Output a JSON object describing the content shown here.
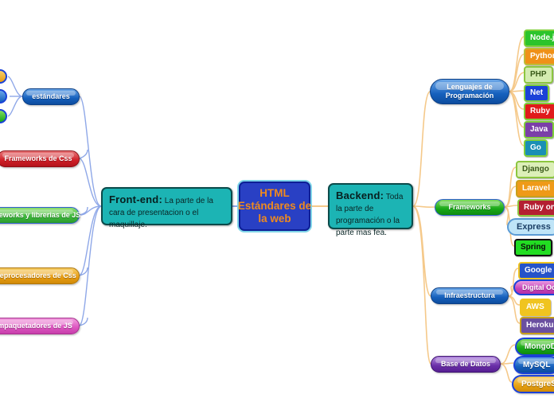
{
  "diagram": {
    "title": "HTML Estándares de la web",
    "background_color": "#ffffff",
    "link_color_left": "#8fa8e8",
    "link_color_right": "#f5c98a"
  },
  "central": {
    "line1": "HTML",
    "line2": "Estándares de",
    "line3": "la web",
    "bg": "#2940c4",
    "text_color": "#f08a1e"
  },
  "branches": {
    "frontend": {
      "title": "Front-end:",
      "description": "La parte de la cara de presentacion o el maquillaje.",
      "bg": "#1cb4b4"
    },
    "backend": {
      "title": "Backend:",
      "description": "Toda la parte de programación o la parte mas fea.",
      "bg": "#1cb4b4"
    }
  },
  "left_nodes": [
    {
      "label": "estándares",
      "color": "#1560bd"
    },
    {
      "label": "Frameworks de Css",
      "color": "#cf1f27"
    },
    {
      "label": "Frameworks y librerias de JS",
      "color": "#18a818"
    },
    {
      "label": "Preprocesadores de Css",
      "color": "#e89c12"
    },
    {
      "label": "Empaquetadores de JS",
      "color": "#dd55c0"
    }
  ],
  "left_leaves": [
    {
      "label": "",
      "color": "#e89c12"
    },
    {
      "label": "",
      "color": "#1560bd"
    },
    {
      "label": "",
      "color": "#18a818"
    }
  ],
  "right_groups": [
    {
      "id": "lenguajes",
      "label_line1": "Lenguajes de",
      "label_line2": "Programación",
      "color": "#1560bd",
      "items": [
        {
          "label": "Node.js",
          "bg": "#2bc42b",
          "border": "#7fcf3a",
          "text": "#ffffff"
        },
        {
          "label": "Python",
          "bg": "#ef9118",
          "border": "#bdbd3a",
          "text": "#ffffff"
        },
        {
          "label": "PHP",
          "bg": "#d4ecb0",
          "border": "#8cc63f",
          "text": "#3a5a1a"
        },
        {
          "label": "Net",
          "bg": "#1b42d8",
          "border": "#7fcf3a",
          "text": "#ffffff"
        },
        {
          "label": "Ruby",
          "bg": "#e01b1b",
          "border": "#7fcf3a",
          "text": "#ffffff"
        },
        {
          "label": "Java",
          "bg": "#7b3fa8",
          "border": "#7fcf3a",
          "text": "#ffffff"
        },
        {
          "label": "Go",
          "bg": "#1a8fb5",
          "border": "#7fcf3a",
          "text": "#ffffff"
        }
      ]
    },
    {
      "id": "frameworks",
      "label_line1": "Frameworks",
      "label_line2": "",
      "color": "#18a818",
      "items": [
        {
          "label": "Django",
          "bg": "#dcefb8",
          "border": "#8cc63f",
          "text": "#3a5a1a"
        },
        {
          "label": "Laravel",
          "bg": "#ef9a18",
          "border": "#c8a01c",
          "text": "#ffffff"
        },
        {
          "label": "Ruby on Rails",
          "bg": "#b41f32",
          "border": "#8cc63f",
          "text": "#ffffff"
        },
        {
          "label": "Express",
          "bg": "#bfe4f7",
          "border": "#5b9bd5",
          "text": "#1c3f66"
        },
        {
          "label": "Spring",
          "bg": "#22dd22",
          "border": "#111111",
          "text": "#0a0a0a"
        }
      ]
    },
    {
      "id": "infraestructura",
      "label_line1": "Infraestructura",
      "label_line2": "",
      "color": "#1560bd",
      "items": [
        {
          "label": "Google Cloud",
          "bg": "#2653c9",
          "border": "#f0c420",
          "text": "#ffffff"
        },
        {
          "label": "Digital Ocean",
          "bg": "#c543b8",
          "border": "#1b42d8",
          "text": "#ffffff"
        },
        {
          "label": "AWS",
          "bg": "#f0c420",
          "border": "#f0c420",
          "text": "#ffffff"
        },
        {
          "label": "Heroku",
          "bg": "#6a4fa0",
          "border": "#c8a01c",
          "text": "#ffffff"
        }
      ]
    },
    {
      "id": "base-de-datos",
      "label_line1": "Base de Datos",
      "label_line2": "",
      "color": "#6a2fa8",
      "items": [
        {
          "label": "MongoDB",
          "bg": "#18a818",
          "border": "#1b42d8",
          "text": "#ffffff"
        },
        {
          "label": "MySQL",
          "bg": "#1560bd",
          "border": "#1b42d8",
          "text": "#ffffff"
        },
        {
          "label": "PostgreSQL",
          "bg": "#e8a112",
          "border": "#1b42d8",
          "text": "#ffffff"
        }
      ]
    }
  ]
}
